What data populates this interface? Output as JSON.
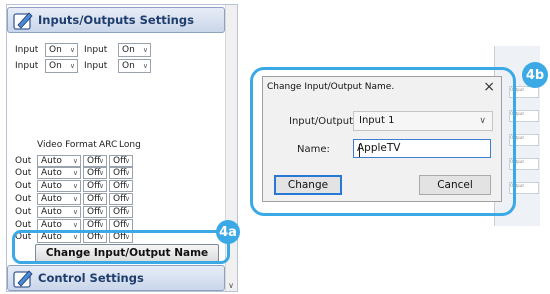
{
  "left_panel": {
    "io_header": "Inputs/Outputs Settings",
    "control_header": "Control Settings",
    "input_rows": [
      {
        "label": "Input",
        "value": "On",
        "label2": "Input",
        "value2": "On"
      },
      {
        "label": "Input",
        "value": "On",
        "label2": "Input",
        "value2": "On"
      }
    ],
    "columns": {
      "video_format": "Video Format",
      "arc": "ARC",
      "long": "Long"
    },
    "output_rows": [
      {
        "label": "Out",
        "format": "Auto",
        "arc": "Off",
        "long": "Off"
      },
      {
        "label": "Out",
        "format": "Auto",
        "arc": "Off",
        "long": "Off"
      },
      {
        "label": "Out",
        "format": "Auto",
        "arc": "Off",
        "long": "Off"
      },
      {
        "label": "Out",
        "format": "Auto",
        "arc": "Off",
        "long": "Off"
      },
      {
        "label": "Out",
        "format": "Auto",
        "arc": "Off",
        "long": "Off"
      },
      {
        "label": "Out",
        "format": "Auto",
        "arc": "Off",
        "long": "Off"
      },
      {
        "label": "Out",
        "format": "Auto",
        "arc": "Off",
        "long": "Off"
      }
    ],
    "change_button": "Change Input/Output Name"
  },
  "callouts": {
    "a": "4a",
    "b": "4b"
  },
  "dialog": {
    "title": "Change Input/Output Name.",
    "close": "×",
    "io_label": "Input/Output:",
    "io_value": "Input 1",
    "name_label": "Name:",
    "name_value": "AppleTV",
    "change_button": "Change",
    "cancel_button": "Cancel"
  },
  "background_rows": [
    "Output",
    "Output",
    "Output",
    "Output",
    "Output"
  ],
  "colors": {
    "accent": "#3aa9e6",
    "header_text": "#1f3d6d"
  }
}
